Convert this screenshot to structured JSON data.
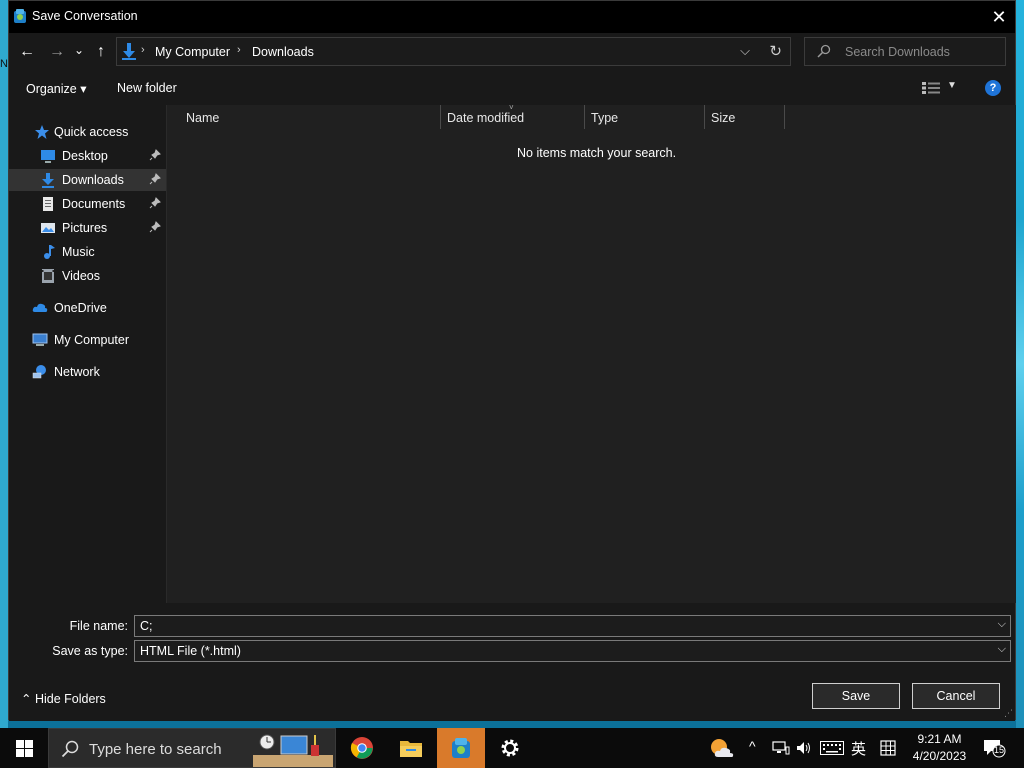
{
  "desktop": {
    "left_label": "N"
  },
  "window": {
    "title": "Save Conversation",
    "close_glyph": "✕"
  },
  "nav": {
    "back_glyph": "←",
    "forward_glyph": "→",
    "recent_glyph": "⌄",
    "up_glyph": "↑",
    "breadcrumbs": [
      "My Computer",
      "Downloads"
    ],
    "breadcrumb_sep": "›",
    "dropdown_glyph": "⌵",
    "refresh_glyph": "↻",
    "search_placeholder": "Search Downloads"
  },
  "toolbar": {
    "organize": "Organize ▾",
    "new_folder": "New folder",
    "help": "?"
  },
  "sidebar": {
    "items": [
      {
        "label": "Quick access",
        "icon": "star-icon",
        "pinned": false
      },
      {
        "label": "Desktop",
        "icon": "desktop-icon",
        "pinned": true
      },
      {
        "label": "Downloads",
        "icon": "download-icon",
        "pinned": true,
        "selected": true
      },
      {
        "label": "Documents",
        "icon": "document-icon",
        "pinned": true
      },
      {
        "label": "Pictures",
        "icon": "pictures-icon",
        "pinned": true
      },
      {
        "label": "Music",
        "icon": "music-icon",
        "pinned": false
      },
      {
        "label": "Videos",
        "icon": "videos-icon",
        "pinned": false
      },
      {
        "label": "OneDrive",
        "icon": "cloud-icon",
        "pinned": false
      },
      {
        "label": "My Computer",
        "icon": "computer-icon",
        "pinned": false
      },
      {
        "label": "Network",
        "icon": "network-icon",
        "pinned": false
      }
    ]
  },
  "columns": [
    "Name",
    "Date modified",
    "Type",
    "Size"
  ],
  "content": {
    "empty_message": "No items match your search.",
    "sort_glyph": "˅"
  },
  "form": {
    "file_name_label": "File name:",
    "file_name_value": "C;",
    "save_type_label": "Save as type:",
    "save_type_value": "HTML File (*.html)",
    "dropdown_glyph": "⌵",
    "hide_folders": "⌃  Hide Folders",
    "save": "Save",
    "cancel": "Cancel"
  },
  "taskbar": {
    "search_text": "Type here to search",
    "tray": {
      "chevron": "^",
      "ime": "英",
      "time": "9:21 AM",
      "date": "4/20/2023",
      "notifications": "15"
    }
  },
  "colors": {
    "accent": "#1f74d8",
    "active_app": "#d97a2b",
    "dialog_bg": "#202020",
    "pane_bg": "#191919"
  }
}
